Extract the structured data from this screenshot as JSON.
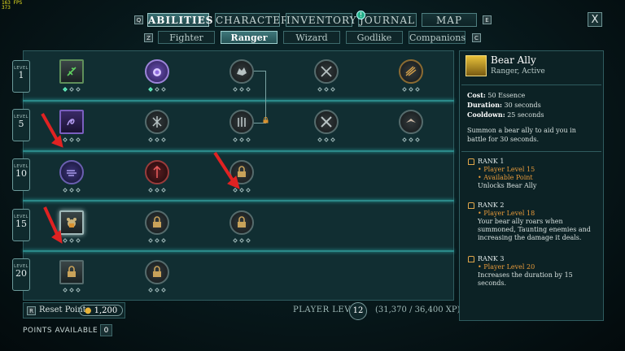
{
  "fps": {
    "line1": "163 FPS",
    "line2": "373"
  },
  "tabs": {
    "q_key": "Q",
    "e_key": "E",
    "items": [
      "ABILITIES",
      "CHARACTER",
      "INVENTORY",
      "JOURNAL",
      "MAP"
    ],
    "active": "ABILITIES",
    "journal_badge": "!",
    "close": "X"
  },
  "subtabs": {
    "z_key": "Z",
    "c_key": "C",
    "items": [
      "Fighter",
      "Ranger",
      "Wizard",
      "Godlike",
      "Companions"
    ],
    "active": "Ranger"
  },
  "levels": [
    {
      "label": "LEVEL",
      "value": "1"
    },
    {
      "label": "LEVEL",
      "value": "5"
    },
    {
      "label": "LEVEL",
      "value": "10"
    },
    {
      "label": "LEVEL",
      "value": "15"
    },
    {
      "label": "LEVEL",
      "value": "20"
    }
  ],
  "bottom": {
    "reset_key": "R",
    "reset_label": "Reset Points",
    "reset_cost": "1,200",
    "player_level_label": "PLAYER LEVEL",
    "player_level": "12",
    "xp": "(31,370 / 36,400 XP)",
    "points_label": "POINTS AVAILABLE",
    "points_value": "0"
  },
  "detail": {
    "title": "Bear Ally",
    "subtitle": "Ranger, Active",
    "cost_label": "Cost:",
    "cost": "50 Essence",
    "duration_label": "Duration:",
    "duration": "30 seconds",
    "cooldown_label": "Cooldown:",
    "cooldown": "25 seconds",
    "description": "Summon a bear ally to aid you in battle for 30 seconds.",
    "ranks": [
      {
        "title": "RANK 1",
        "reqs": [
          "• Player Level 15",
          "• Available Point"
        ],
        "text": "Unlocks Bear Ally"
      },
      {
        "title": "RANK 2",
        "reqs": [
          "• Player Level 18"
        ],
        "text": "Your bear ally roars when summoned, Taunting enemies and increasing the damage it deals."
      },
      {
        "title": "RANK 3",
        "reqs": [
          "• Player Level 20"
        ],
        "text": "Increases the duration by 15 seconds."
      }
    ]
  },
  "colors": {
    "accent": "#2c8a8a",
    "gold": "#e79a3a",
    "pip_on": "#3cd1a0",
    "arrow": "#e02222"
  }
}
